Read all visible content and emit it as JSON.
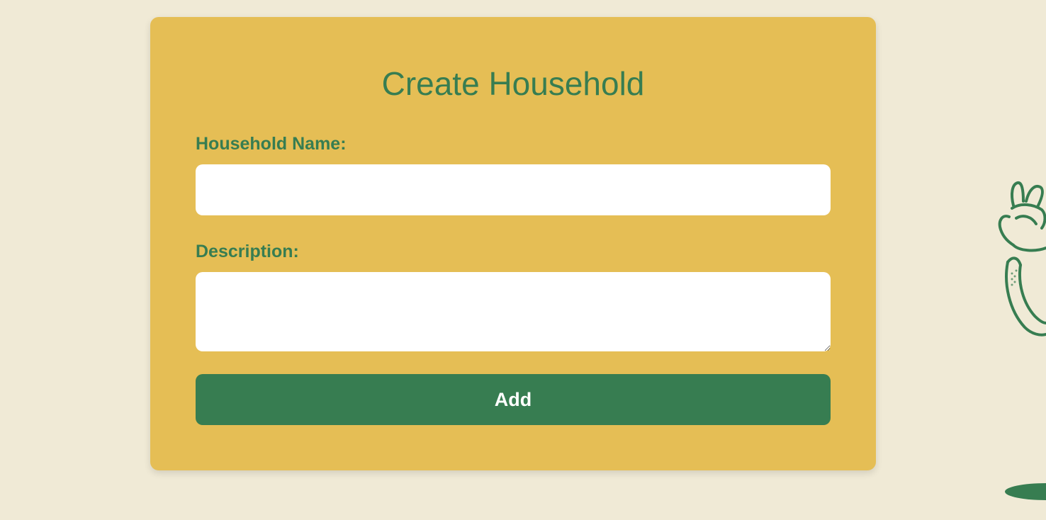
{
  "form": {
    "title": "Create Household",
    "household_name_label": "Household Name:",
    "household_name_value": "",
    "description_label": "Description:",
    "description_value": "",
    "add_button_label": "Add"
  },
  "colors": {
    "page_background": "#f0ead6",
    "card_background": "#e5be55",
    "accent_green": "#377d51",
    "input_background": "#ffffff"
  },
  "decorations": {
    "right_illustration": "peace-sign-hand-icon",
    "bottom_right_shape": "green-ellipse-icon"
  }
}
